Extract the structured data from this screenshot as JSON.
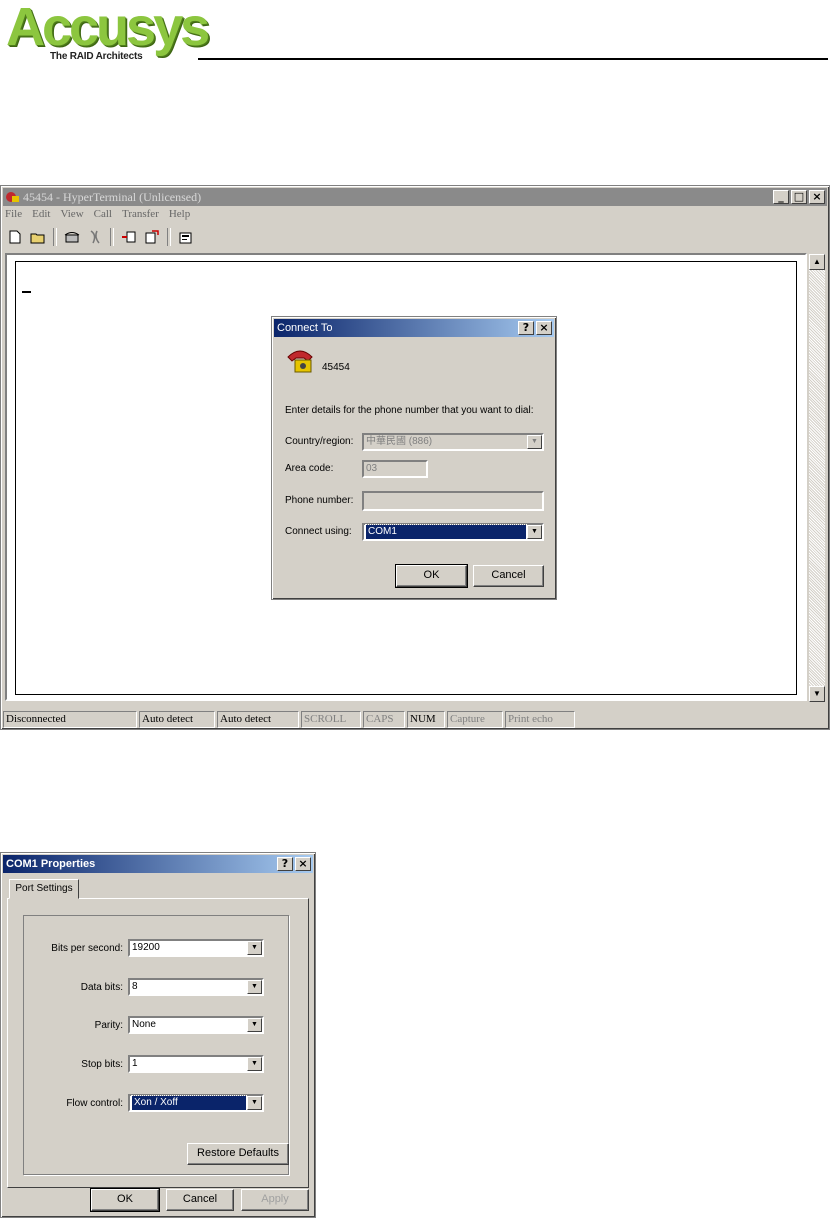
{
  "logo": {
    "brand": "Accusys",
    "tagline": "The RAID Architects"
  },
  "hyperterminal": {
    "title": "45454 - HyperTerminal (Unlicensed)",
    "menu": [
      "File",
      "Edit",
      "View",
      "Call",
      "Transfer",
      "Help"
    ],
    "status": {
      "connection": "Disconnected",
      "detect1": "Auto detect",
      "detect2": "Auto detect",
      "scroll": "SCROLL",
      "caps": "CAPS",
      "num": "NUM",
      "capture": "Capture",
      "print_echo": "Print echo"
    }
  },
  "connect_to": {
    "title": "Connect To",
    "connection_name": "45454",
    "instruction": "Enter details for the phone number that you want to dial:",
    "country_label": "Country/region:",
    "country_value": "中華民國 (886)",
    "area_label": "Area code:",
    "area_value": "03",
    "phone_label": "Phone number:",
    "phone_value": "",
    "connect_label": "Connect using:",
    "connect_value": "COM1",
    "ok": "OK",
    "cancel": "Cancel"
  },
  "com1": {
    "title": "COM1 Properties",
    "tab": "Port Settings",
    "bits_label": "Bits per second:",
    "bits_value": "19200",
    "data_label": "Data bits:",
    "data_value": "8",
    "parity_label": "Parity:",
    "parity_value": "None",
    "stop_label": "Stop bits:",
    "stop_value": "1",
    "flow_label": "Flow control:",
    "flow_value": "Xon / Xoff",
    "restore": "Restore Defaults",
    "ok": "OK",
    "cancel": "Cancel",
    "apply": "Apply"
  }
}
